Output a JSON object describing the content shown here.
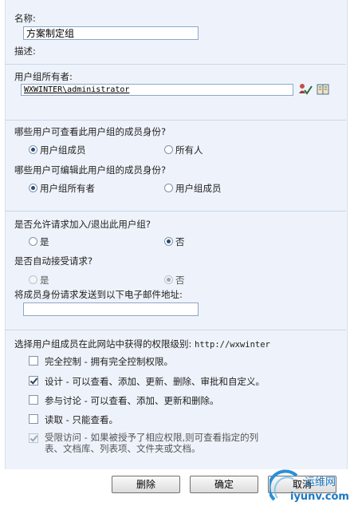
{
  "group": {
    "name_label": "名称:",
    "name_value": "方案制定组",
    "desc_label": "描述:"
  },
  "owner": {
    "label": "用户组所有者:",
    "value": "WXWINTER\\administrator"
  },
  "view_membership": {
    "question": "哪些用户可查看此用户组的成员身份?",
    "options": [
      "用户组成员",
      "所有人"
    ],
    "selected": 0
  },
  "edit_membership": {
    "question": "哪些用户可编辑此用户组的成员身份?",
    "options": [
      "用户组所有者",
      "用户组成员"
    ],
    "selected": 0
  },
  "allow_requests": {
    "question": "是否允许请求加入/退出此用户组?",
    "options": [
      "是",
      "否"
    ],
    "selected": 1
  },
  "auto_accept": {
    "question": "是否自动接受请求?",
    "options": [
      "是",
      "否"
    ],
    "selected": 1,
    "disabled": true
  },
  "email": {
    "label": "将成员身份请求发送到以下电子邮件地址:",
    "value": ""
  },
  "permissions": {
    "label": "选择用户组成员在此网站中获得的权限级别: ",
    "site": "http://wxwinter",
    "items": [
      {
        "text": "完全控制 - 拥有完全控制权限。",
        "checked": false,
        "disabled": false
      },
      {
        "text": "设计 - 可以查看、添加、更新、删除、审批和自定义。",
        "checked": true,
        "disabled": false
      },
      {
        "text": "参与讨论 - 可以查看、添加、更新和删除。",
        "checked": false,
        "disabled": false
      },
      {
        "text": "读取 - 只能查看。",
        "checked": false,
        "disabled": false
      },
      {
        "text_line1": "受限访问 - 如果被授予了相应权限,则可查看指定的列",
        "text_line2": "表、文档库、列表项、文件夹或文档。",
        "checked": true,
        "disabled": true
      }
    ]
  },
  "buttons": {
    "delete": "删除",
    "ok": "确定",
    "cancel": "取消"
  },
  "watermark": {
    "line1": "运维网",
    "line2": "iyunv.com"
  },
  "icons": {
    "check_names": "check-names-icon",
    "browse": "address-book-icon"
  }
}
